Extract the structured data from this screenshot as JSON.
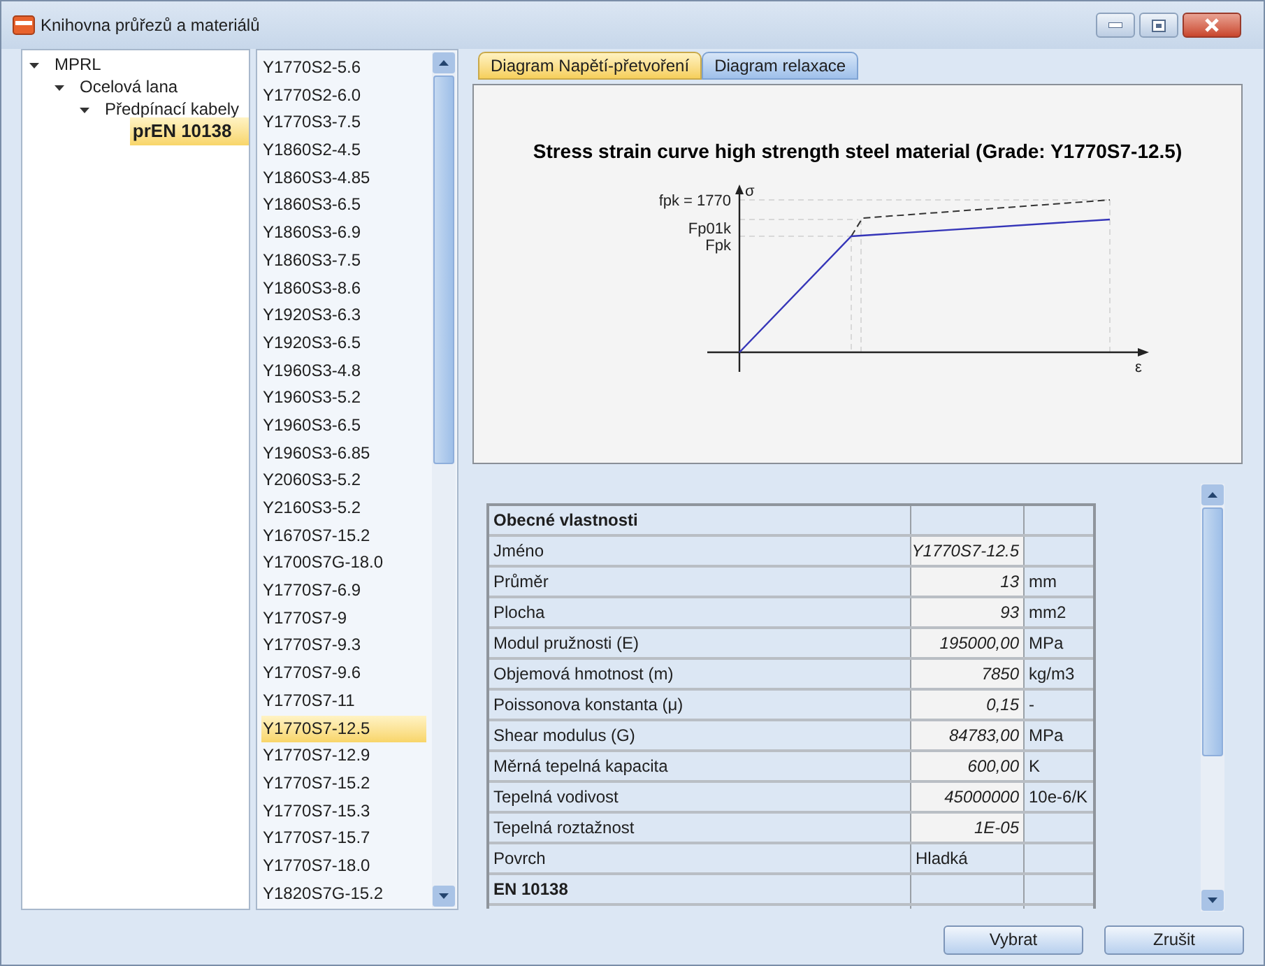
{
  "window": {
    "title": "Knihovna průřezů a materiálů"
  },
  "tree": [
    {
      "label": "MPRL",
      "expanded": true,
      "selected": false,
      "children": [
        {
          "label": "Ocelová lana",
          "expanded": true,
          "selected": false,
          "children": [
            {
              "label": "Předpínací kabely",
              "expanded": true,
              "selected": false,
              "children": [
                {
                  "label": "prEN 10138",
                  "selected": true
                }
              ]
            }
          ]
        }
      ]
    }
  ],
  "materials": [
    {
      "label": "Y1770S2-5.6",
      "selected": false
    },
    {
      "label": "Y1770S2-6.0",
      "selected": false
    },
    {
      "label": "Y1770S3-7.5",
      "selected": false
    },
    {
      "label": "Y1860S2-4.5",
      "selected": false
    },
    {
      "label": "Y1860S3-4.85",
      "selected": false
    },
    {
      "label": "Y1860S3-6.5",
      "selected": false
    },
    {
      "label": "Y1860S3-6.9",
      "selected": false
    },
    {
      "label": "Y1860S3-7.5",
      "selected": false
    },
    {
      "label": "Y1860S3-8.6",
      "selected": false
    },
    {
      "label": "Y1920S3-6.3",
      "selected": false
    },
    {
      "label": "Y1920S3-6.5",
      "selected": false
    },
    {
      "label": "Y1960S3-4.8",
      "selected": false
    },
    {
      "label": "Y1960S3-5.2",
      "selected": false
    },
    {
      "label": "Y1960S3-6.5",
      "selected": false
    },
    {
      "label": "Y1960S3-6.85",
      "selected": false
    },
    {
      "label": "Y2060S3-5.2",
      "selected": false
    },
    {
      "label": "Y2160S3-5.2",
      "selected": false
    },
    {
      "label": "Y1670S7-15.2",
      "selected": false
    },
    {
      "label": "Y1700S7G-18.0",
      "selected": false
    },
    {
      "label": "Y1770S7-6.9",
      "selected": false
    },
    {
      "label": "Y1770S7-9",
      "selected": false
    },
    {
      "label": "Y1770S7-9.3",
      "selected": false
    },
    {
      "label": "Y1770S7-9.6",
      "selected": false
    },
    {
      "label": "Y1770S7-11",
      "selected": false
    },
    {
      "label": "Y1770S7-12.5",
      "selected": true
    },
    {
      "label": "Y1770S7-12.9",
      "selected": false
    },
    {
      "label": "Y1770S7-15.2",
      "selected": false
    },
    {
      "label": "Y1770S7-15.3",
      "selected": false
    },
    {
      "label": "Y1770S7-15.7",
      "selected": false
    },
    {
      "label": "Y1770S7-18.0",
      "selected": false
    },
    {
      "label": "Y1820S7G-15.2",
      "selected": false
    }
  ],
  "tabs": [
    {
      "label": "Diagram Napětí-přetvoření",
      "selected": true
    },
    {
      "label": "Diagram relaxace",
      "selected": false
    }
  ],
  "diagram": {
    "title": "Stress strain curve high strength steel material (Grade: Y1770S7-12.5)",
    "y_axis": "σ",
    "x_axis": "ε",
    "labels": [
      "fpk = 1770",
      "Fp01k",
      "Fpk"
    ]
  },
  "properties": [
    {
      "kind": "section",
      "label": "Obecné vlastnosti"
    },
    {
      "kind": "row",
      "label": "Jméno",
      "value": "Y1770S7-12.5"
    },
    {
      "kind": "row",
      "label": "Průměr",
      "value": "13",
      "unit": "mm"
    },
    {
      "kind": "row",
      "label": "Plocha",
      "value": "93",
      "unit": "mm2"
    },
    {
      "kind": "row",
      "label": "Modul pružnosti (E)",
      "value": "195000,00",
      "unit": "MPa"
    },
    {
      "kind": "row",
      "label": "Objemová hmotnost (m)",
      "value": "7850",
      "unit": "kg/m3"
    },
    {
      "kind": "row",
      "label": "Poissonova konstanta (μ)",
      "value": "0,15",
      "unit": "-"
    },
    {
      "kind": "row",
      "label": "Shear modulus (G)",
      "value": "84783,00",
      "unit": "MPa"
    },
    {
      "kind": "row",
      "label": "Měrná tepelná kapacita",
      "value": "600,00",
      "unit": "K"
    },
    {
      "kind": "row",
      "label": "Tepelná vodivost",
      "value": "45000000",
      "unit": "10e-6/K"
    },
    {
      "kind": "row",
      "label": "Tepelná roztažnost",
      "value": "1E-05"
    },
    {
      "kind": "choice",
      "label": "Povrch",
      "value": "Hladká"
    },
    {
      "kind": "section",
      "label": "EN 10138"
    }
  ],
  "buttons": [
    "Vybrat",
    "Zrušit"
  ]
}
